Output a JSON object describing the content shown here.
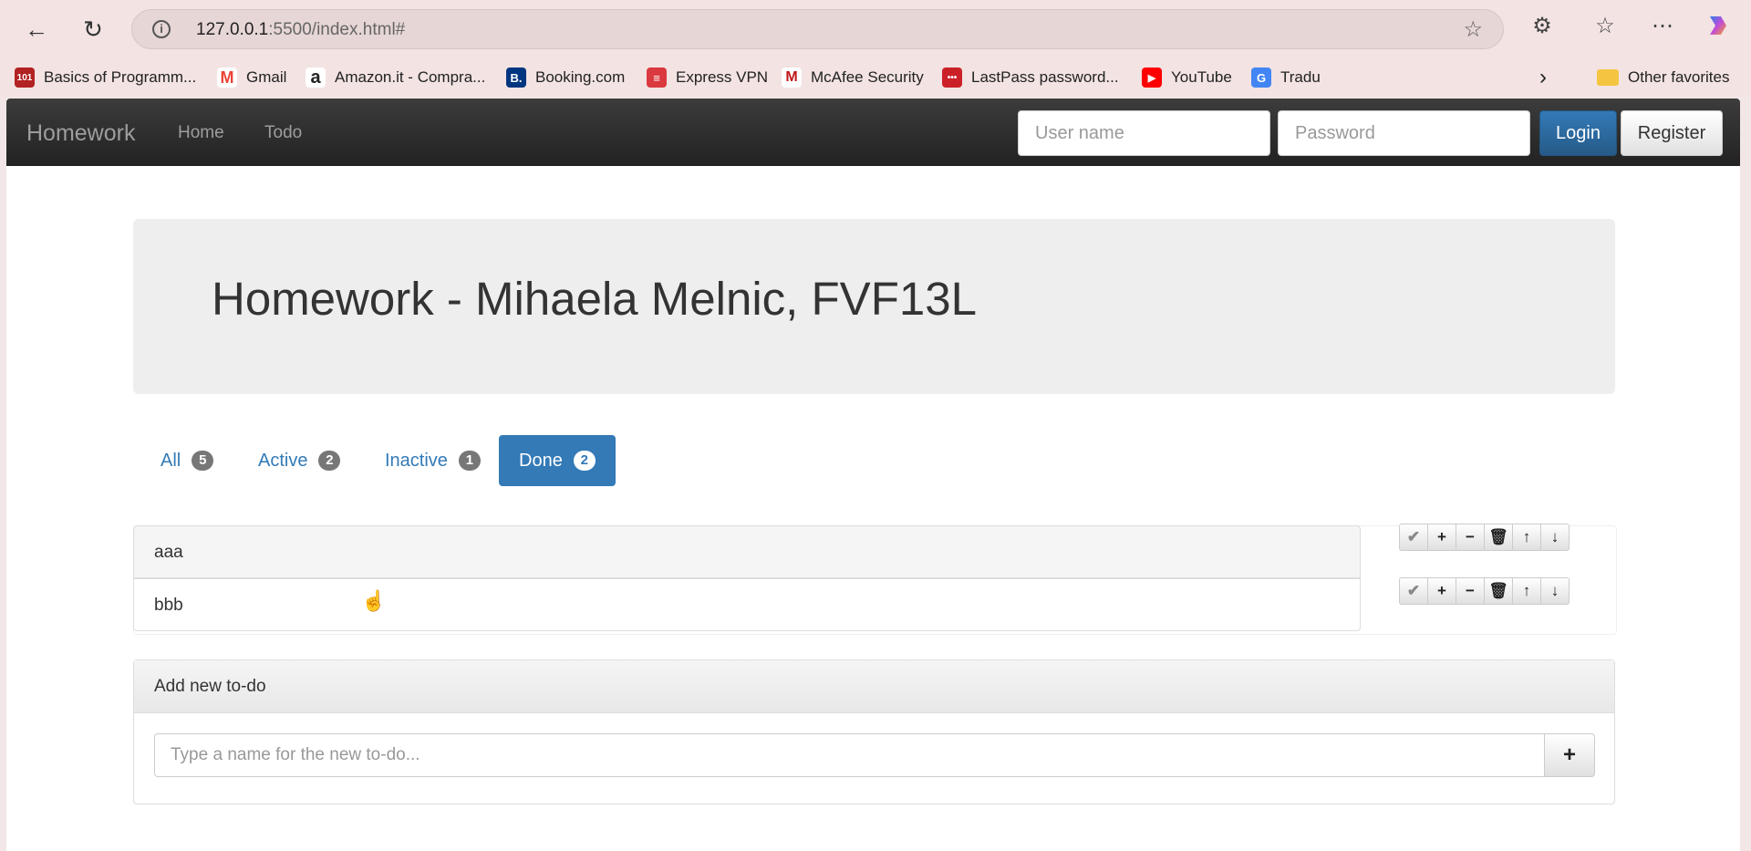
{
  "browser": {
    "url_host": "127.0.0.1",
    "url_rest": ":5500/index.html#",
    "bookmarks": [
      {
        "label": "Basics of Programm...",
        "color": "#b22222",
        "glyph": "101"
      },
      {
        "label": "Gmail",
        "color": "#ea4335",
        "glyph": "M"
      },
      {
        "label": "Amazon.it - Compra...",
        "color": "#222222",
        "glyph": "a"
      },
      {
        "label": "Booking.com",
        "color": "#003580",
        "glyph": "B."
      },
      {
        "label": "Express VPN",
        "color": "#da3940",
        "glyph": "≡"
      },
      {
        "label": "McAfee Security",
        "color": "#c01818",
        "glyph": "M"
      },
      {
        "label": "LastPass password...",
        "color": "#cc2029",
        "glyph": "•••"
      },
      {
        "label": "YouTube",
        "color": "#ff0000",
        "glyph": "▶"
      },
      {
        "label": "Tradu",
        "color": "#4285f4",
        "glyph": "G"
      }
    ],
    "other_favorites": "Other favorites"
  },
  "navbar": {
    "brand": "Homework",
    "links": [
      "Home",
      "Todo"
    ],
    "username_placeholder": "User name",
    "password_placeholder": "Password",
    "login": "Login",
    "register": "Register"
  },
  "jumbotron": {
    "title": "Homework - Mihaela Melnic, FVF13L"
  },
  "tabs": [
    {
      "label": "All",
      "count": "5"
    },
    {
      "label": "Active",
      "count": "2"
    },
    {
      "label": "Inactive",
      "count": "1"
    },
    {
      "label": "Done",
      "count": "2"
    }
  ],
  "todos": [
    {
      "name": "aaa"
    },
    {
      "name": "bbb"
    }
  ],
  "new_todo": {
    "heading": "Add new to-do",
    "placeholder": "Type a name for the new to-do...",
    "add_icon": "+"
  },
  "colors": {
    "primary": "#337ab7",
    "navbar": "#222222",
    "badge": "#777777"
  }
}
